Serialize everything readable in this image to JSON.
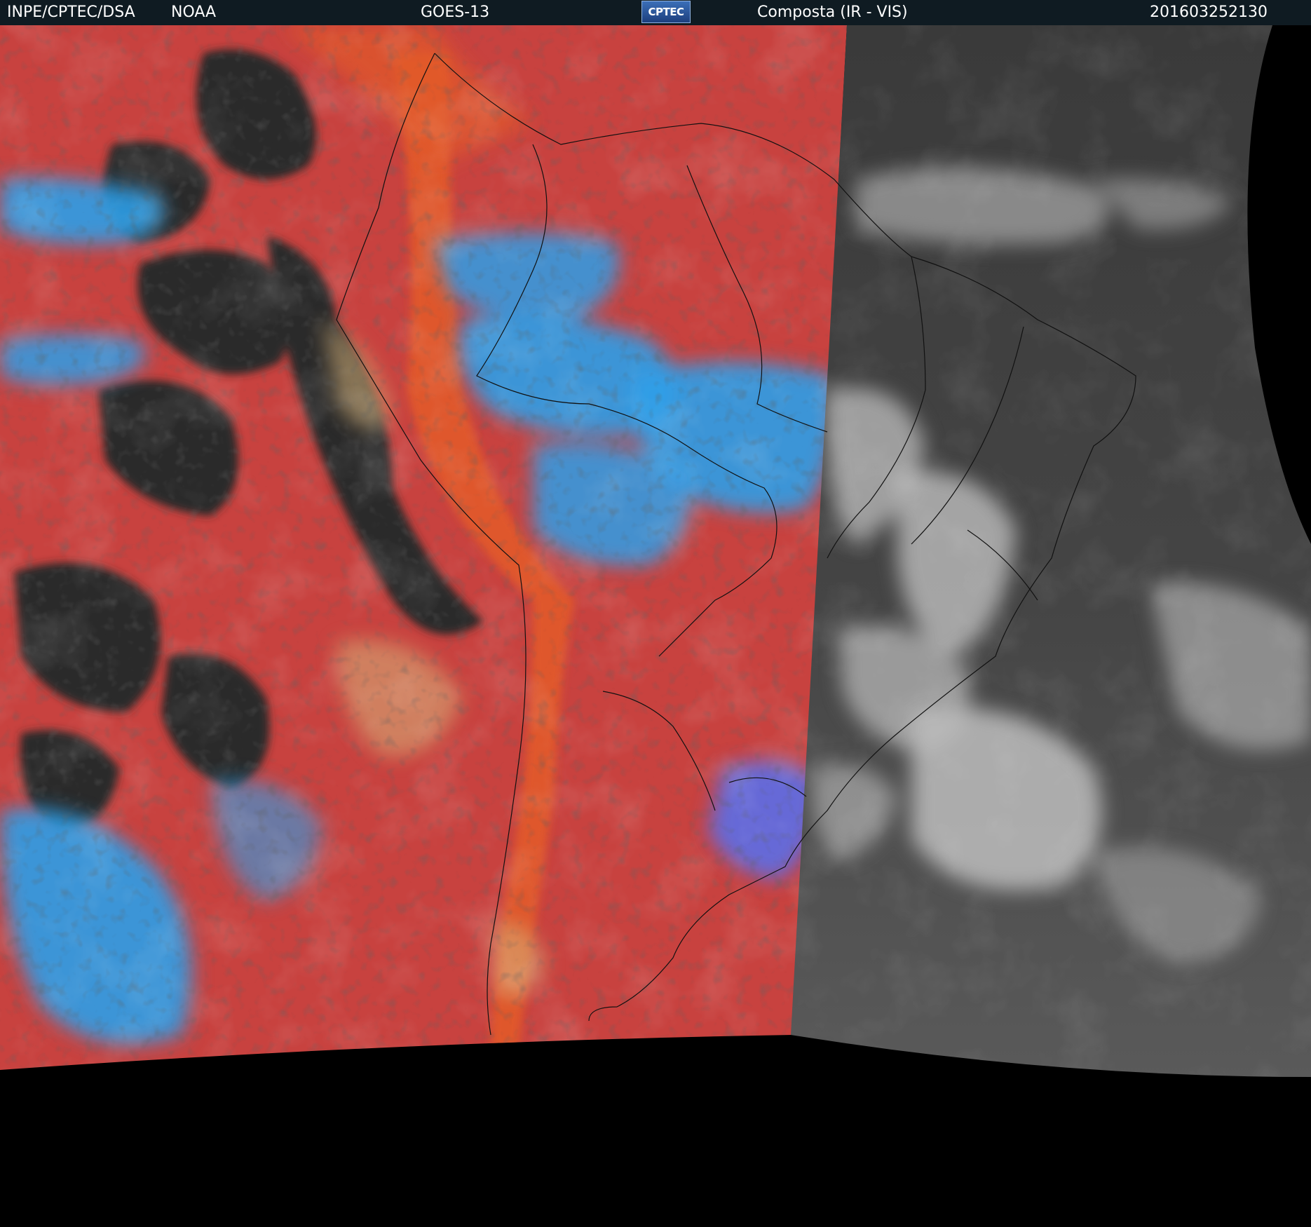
{
  "header": {
    "organization": "INPE/CPTEC/DSA",
    "agency": "NOAA",
    "satellite": "GOES-13",
    "logo_text": "CPTEC",
    "product": "Composta (IR - VIS)",
    "timestamp": "201603252130"
  },
  "colors": {
    "header_bg": "#0f1b22",
    "ir_red": "#c8423f",
    "ir_orange": "#e25a2c",
    "ir_blue": "#2f9ee8",
    "vis_gray": "#4a4a4a",
    "space": "#000000"
  },
  "icons": [
    "cptec-logo"
  ]
}
